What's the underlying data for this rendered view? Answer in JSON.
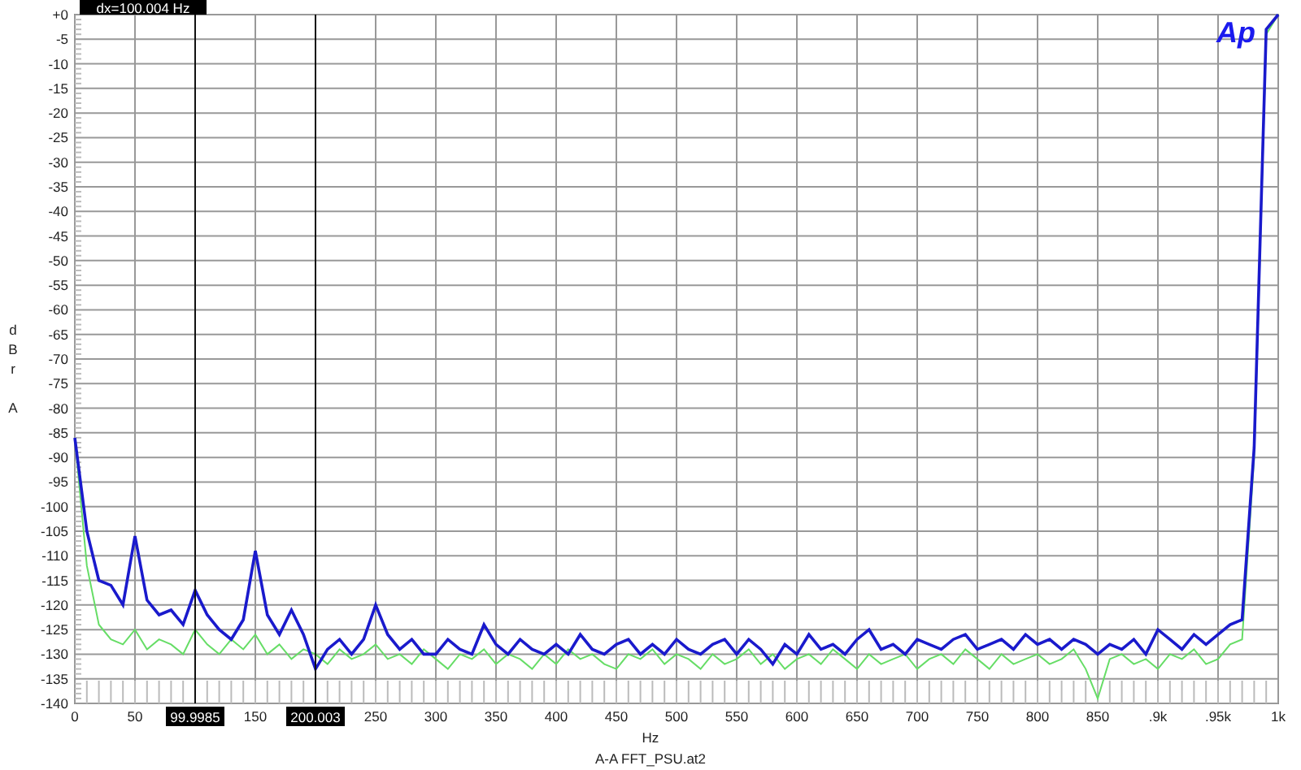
{
  "chart": {
    "chart_data": {
      "type": "line",
      "xlabel": "Hz",
      "ylabel": "dBr A",
      "x": [
        0,
        10,
        20,
        30,
        40,
        50,
        60,
        70,
        80,
        90,
        100,
        110,
        120,
        130,
        140,
        150,
        160,
        170,
        180,
        190,
        200,
        210,
        220,
        230,
        240,
        250,
        260,
        270,
        280,
        290,
        300,
        310,
        320,
        330,
        340,
        350,
        360,
        370,
        380,
        390,
        400,
        410,
        420,
        430,
        440,
        450,
        460,
        470,
        480,
        490,
        500,
        510,
        520,
        530,
        540,
        550,
        560,
        570,
        580,
        590,
        600,
        610,
        620,
        630,
        640,
        650,
        660,
        670,
        680,
        690,
        700,
        710,
        720,
        730,
        740,
        750,
        760,
        770,
        780,
        790,
        800,
        810,
        820,
        830,
        840,
        850,
        860,
        870,
        880,
        890,
        900,
        910,
        920,
        930,
        940,
        950,
        960,
        970,
        980,
        990,
        1000
      ],
      "series": [
        {
          "color": "#66dd66",
          "values": [
            -86,
            -112,
            -124,
            -127,
            -128,
            -125,
            -129,
            -127,
            -128,
            -130,
            -125,
            -128,
            -130,
            -127,
            -129,
            -126,
            -130,
            -128,
            -131,
            -129,
            -130,
            -132,
            -129,
            -131,
            -130,
            -128,
            -131,
            -130,
            -132,
            -129,
            -131,
            -133,
            -130,
            -131,
            -129,
            -132,
            -130,
            -131,
            -133,
            -130,
            -132,
            -129,
            -131,
            -130,
            -132,
            -133,
            -130,
            -131,
            -129,
            -132,
            -130,
            -131,
            -133,
            -130,
            -132,
            -131,
            -129,
            -132,
            -130,
            -133,
            -131,
            -130,
            -132,
            -129,
            -131,
            -133,
            -130,
            -132,
            -131,
            -130,
            -133,
            -131,
            -130,
            -132,
            -129,
            -131,
            -133,
            -130,
            -132,
            -131,
            -130,
            -132,
            -131,
            -129,
            -133,
            -139,
            -131,
            -130,
            -132,
            -131,
            -133,
            -130,
            -131,
            -129,
            -132,
            -131,
            -128,
            -127,
            -90,
            -4,
            0
          ]
        },
        {
          "color": "#1a1acc",
          "values": [
            -86,
            -105,
            -115,
            -116,
            -120,
            -106,
            -119,
            -122,
            -121,
            -124,
            -117,
            -122,
            -125,
            -127,
            -123,
            -109,
            -122,
            -126,
            -121,
            -126,
            -133,
            -129,
            -127,
            -130,
            -127,
            -120,
            -126,
            -129,
            -127,
            -130,
            -130,
            -127,
            -129,
            -130,
            -124,
            -128,
            -130,
            -127,
            -129,
            -130,
            -128,
            -130,
            -126,
            -129,
            -130,
            -128,
            -127,
            -130,
            -128,
            -130,
            -127,
            -129,
            -130,
            -128,
            -127,
            -130,
            -127,
            -129,
            -132,
            -128,
            -130,
            -126,
            -129,
            -128,
            -130,
            -127,
            -125,
            -129,
            -128,
            -130,
            -127,
            -128,
            -129,
            -127,
            -126,
            -129,
            -128,
            -127,
            -129,
            -126,
            -128,
            -127,
            -129,
            -127,
            -128,
            -130,
            -128,
            -129,
            -127,
            -130,
            -125,
            -127,
            -129,
            -126,
            -128,
            -126,
            -124,
            -123,
            -88,
            -3,
            0
          ]
        }
      ],
      "xlim": [
        0,
        1000
      ],
      "ylim": [
        -140,
        0
      ],
      "grid": true,
      "xticks": [
        0,
        50,
        150,
        250,
        300,
        350,
        400,
        450,
        500,
        550,
        600,
        650,
        700,
        750,
        800,
        850,
        {
          "value": 900,
          "label": ".9k"
        },
        {
          "value": 950,
          "label": ".95k"
        },
        {
          "value": 1000,
          "label": "1k"
        }
      ],
      "yticks": [
        {
          "value": 0,
          "label": "+0"
        },
        -5,
        -10,
        -15,
        -20,
        -25,
        -30,
        -35,
        -40,
        -45,
        -50,
        -55,
        -60,
        -65,
        -70,
        -75,
        -80,
        -85,
        -90,
        -95,
        -100,
        -105,
        -110,
        -115,
        -120,
        -125,
        -130,
        -135,
        -140
      ],
      "annotations": [
        {
          "text": "99.9985",
          "x": 99.9985
        },
        {
          "text": "200.003",
          "x": 200.003
        },
        {
          "text": "dx=100.004 Hz"
        }
      ]
    },
    "logo": "Ap",
    "file_name": "A-A FFT_PSU.at2"
  }
}
